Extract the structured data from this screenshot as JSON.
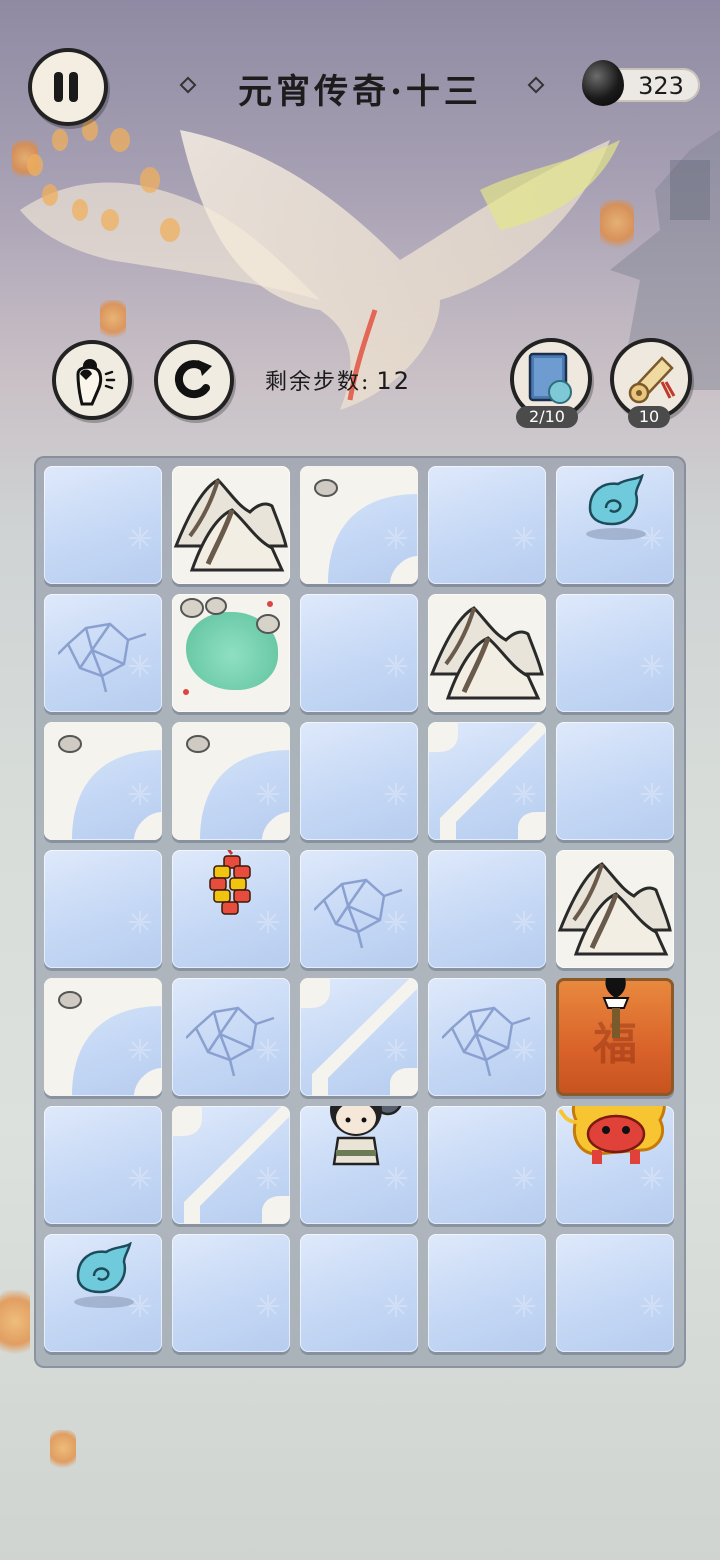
{
  "header": {
    "title": "元宵传奇·十三",
    "currency": "323"
  },
  "toolbar": {
    "steps_label": "剩余步数:",
    "steps_value": "12"
  },
  "items": [
    {
      "icon": "book-icon",
      "count": "2/10"
    },
    {
      "icon": "scroll-icon",
      "count": "10"
    }
  ],
  "board": {
    "rows": 7,
    "cols": 5,
    "tiles": [
      [
        "ice",
        "mountain",
        "path-corner",
        "ice",
        "spirit"
      ],
      [
        "cracked-ice",
        "pond",
        "ice",
        "mountain",
        "ice"
      ],
      [
        "path-corner",
        "path-corner",
        "ice",
        "path-diagonal",
        "ice"
      ],
      [
        "ice",
        "firecracker",
        "cracked-ice",
        "ice",
        "mountain"
      ],
      [
        "path-corner",
        "cracked-ice",
        "path-diagonal",
        "cracked-ice",
        "fire-brazier"
      ],
      [
        "ice",
        "path-diagonal",
        "hero",
        "ice",
        "fire-lion"
      ],
      [
        "spirit",
        "ice",
        "ice",
        "ice",
        "ice"
      ]
    ]
  },
  "colors": {
    "ice": "#c5d8f5",
    "white_tile": "#f5f3ee",
    "fire": "#d9632a",
    "pond": "#6ccaa8",
    "ink": "#1c1c1c"
  }
}
